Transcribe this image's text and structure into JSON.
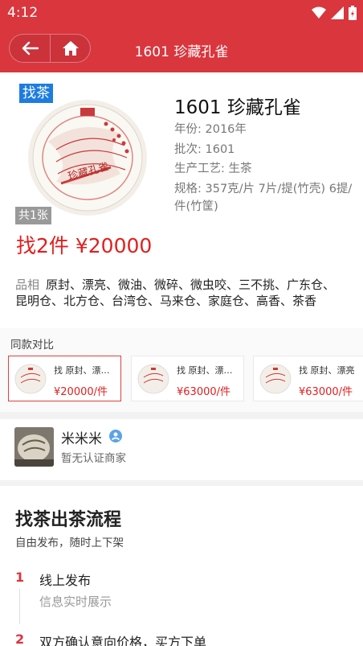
{
  "status": {
    "time": "4:12"
  },
  "header": {
    "title": "1601 珍藏孔雀"
  },
  "product": {
    "find_tag": "找茶",
    "image_count": "共1张",
    "title": "1601 珍藏孔雀",
    "year": "年份: 2016年",
    "batch": "批次: 1601",
    "craft": "生产工艺: 生茶",
    "spec": "规格: 357克/片 7片/提(竹壳) 6提/件(竹筐)",
    "price_line": "找2件 ¥20000",
    "quality_label": "品相",
    "quality_text": "原封、漂亮、微油、微碎、微虫咬、三不挑、广东仓、昆明仓、北方仓、台湾仓、马来仓、家庭仓、高香、茶香"
  },
  "compare": {
    "heading": "同款对比",
    "cards": [
      {
        "text": "找 原封、漂…",
        "price": "¥20000/件"
      },
      {
        "text": "找 原封、漂…",
        "price": "¥63000/件"
      },
      {
        "text": "找 原封、漂亮",
        "price": "¥63000/件"
      }
    ]
  },
  "seller": {
    "name": "米米米",
    "subtitle": "暂无认证商家"
  },
  "flow": {
    "title": "找茶出茶流程",
    "subtitle": "自由发布，随时上下架",
    "steps": [
      {
        "num": "1",
        "title": "线上发布",
        "desc": "信息实时展示"
      },
      {
        "num": "2",
        "title": "双方确认意向价格，买方下单"
      }
    ]
  },
  "colors": {
    "brand_red": "#d9363e",
    "price_red": "#e02020",
    "tag_blue": "#1d7ce0"
  }
}
